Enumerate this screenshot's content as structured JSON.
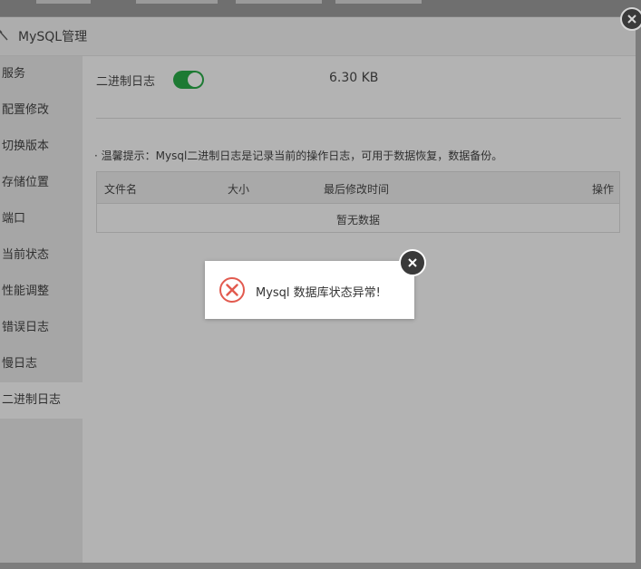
{
  "dialog": {
    "title": "MySQL管理"
  },
  "sidebar": {
    "items": [
      {
        "label": "服务"
      },
      {
        "label": "配置修改"
      },
      {
        "label": "切换版本"
      },
      {
        "label": "存储位置"
      },
      {
        "label": "端口"
      },
      {
        "label": "当前状态"
      },
      {
        "label": "性能调整"
      },
      {
        "label": "错误日志"
      },
      {
        "label": "慢日志"
      },
      {
        "label": "二进制日志"
      }
    ],
    "active_index": 9
  },
  "binlog": {
    "label": "二进制日志",
    "enabled": true,
    "size": "6.30 KB",
    "tip": "温馨提示：Mysql二进制日志是记录当前的操作日志，可用于数据恢复，数据备份。"
  },
  "table": {
    "headers": [
      "文件名",
      "大小",
      "最后修改时间",
      "操作"
    ],
    "empty_text": "暂无数据"
  },
  "message": {
    "text": "Mysql 数据库状态异常!"
  },
  "colors": {
    "toggle_on": "#1d7a33",
    "error_icon": "#e25a4f"
  }
}
